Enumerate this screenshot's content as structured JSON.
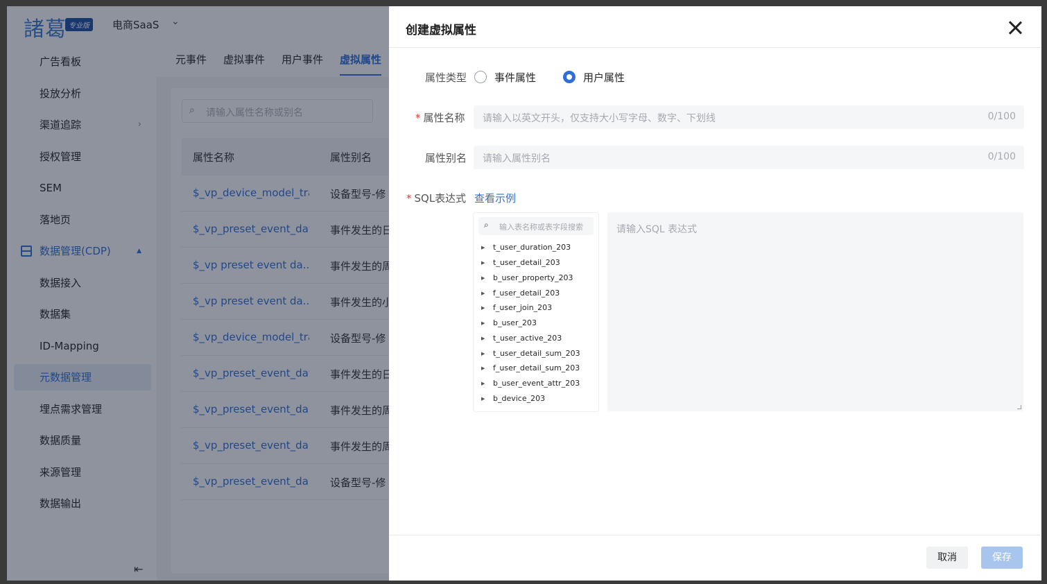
{
  "app": {
    "logo_text": "諸葛",
    "logo_badge": "专业版",
    "product_name": "电商SaaS"
  },
  "sidebar": {
    "items": [
      {
        "label": "广告看板"
      },
      {
        "label": "投放分析"
      },
      {
        "label": "渠道追踪"
      },
      {
        "label": "授权管理"
      },
      {
        "label": "SEM"
      },
      {
        "label": "落地页"
      },
      {
        "label": "数据管理(CDP)"
      },
      {
        "label": "数据接入"
      },
      {
        "label": "数据集"
      },
      {
        "label": "ID-Mapping"
      },
      {
        "label": "元数据管理"
      },
      {
        "label": "埋点需求管理"
      },
      {
        "label": "数据质量"
      },
      {
        "label": "来源管理"
      },
      {
        "label": "数据输出"
      }
    ]
  },
  "tabs": [
    "元事件",
    "虚拟事件",
    "用户事件",
    "虚拟属性"
  ],
  "list": {
    "search_placeholder": "请输入属性名称或别名",
    "columns": [
      "属性名称",
      "属性别名"
    ],
    "rows": [
      {
        "name": "$_vp_device_model_tran",
        "alias": "设备型号-修"
      },
      {
        "name": "$_vp_preset_event_day",
        "alias": "事件发生的日"
      },
      {
        "name": "$_vp preset event da..",
        "alias": "事件发生的周"
      },
      {
        "name": "$_vp preset event da...",
        "alias": "事件发生的小"
      },
      {
        "name": "$_vp_device_model_tran",
        "alias": "设备型号-修"
      },
      {
        "name": "$_vp_preset_event_day",
        "alias": "事件发生的日"
      },
      {
        "name": "$_vp_preset_event_da...",
        "alias": "事件发生的周"
      },
      {
        "name": "$_vp_preset_event_da...",
        "alias": "事件发生的周"
      },
      {
        "name": "$_vp_preset_event_da...",
        "alias": "设备型号-修"
      }
    ]
  },
  "drawer": {
    "title": "创建虚拟属性",
    "type_label": "属性类型",
    "type_options": [
      "事件属性",
      "用户属性"
    ],
    "type_selected": "用户属性",
    "name_label": "属性名称",
    "name_placeholder": "请输入以英文开头，仅支持大小写字母、数字、下划线",
    "name_count": "0/100",
    "alias_label": "属性别名",
    "alias_placeholder": "请输入属性别名",
    "alias_count": "0/100",
    "sql_label": "SQL表达式",
    "example_link": "查看示例",
    "table_search_placeholder": "输入表名称或表字段搜索",
    "tables": [
      "t_user_duration_203",
      "t_user_detail_203",
      "b_user_property_203",
      "f_user_detail_203",
      "f_user_join_203",
      "b_user_203",
      "t_user_active_203",
      "t_user_detail_sum_203",
      "f_user_detail_sum_203",
      "b_user_event_attr_203",
      "b_device_203"
    ],
    "sql_placeholder": "请输入SQL 表达式",
    "cancel_label": "取消",
    "save_label": "保存"
  }
}
